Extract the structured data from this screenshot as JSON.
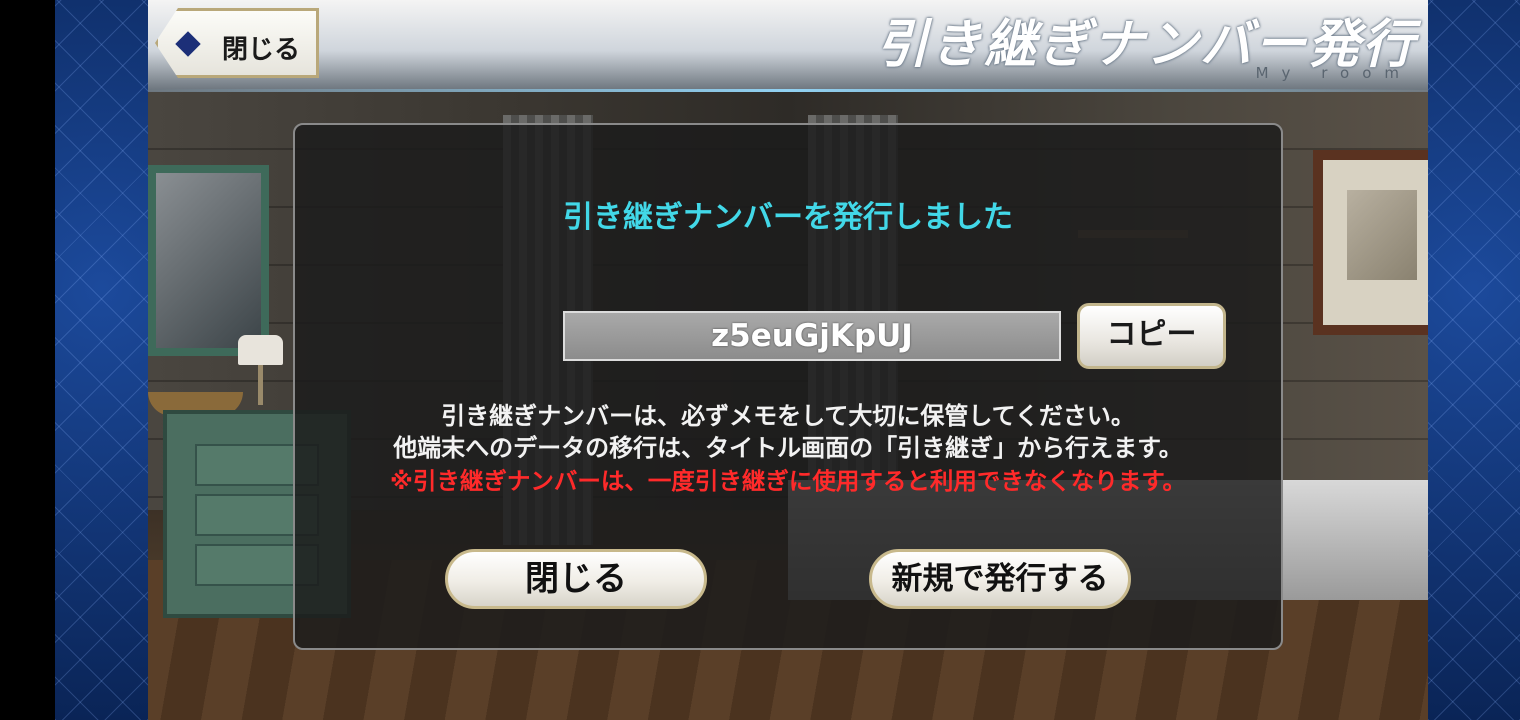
{
  "header": {
    "back_label": "閉じる",
    "title": "引き継ぎナンバー発行",
    "subtitle": "My room"
  },
  "dialog": {
    "heading": "引き継ぎナンバーを発行しました",
    "transfer_code": "z5euGjKpUJ",
    "copy_label": "コピー",
    "info_line_1": "引き継ぎナンバーは、必ずメモをして大切に保管してください。",
    "info_line_2": "他端末へのデータの移行は、タイトル画面の「引き継ぎ」から行えます。",
    "warning": "※引き継ぎナンバーは、一度引き継ぎに使用すると利用できなくなります。",
    "close_label": "閉じる",
    "reissue_label": "新規で発行する"
  },
  "colors": {
    "heading": "#42d8e8",
    "warning": "#ff2a2a",
    "frame": "#0d2d6b"
  },
  "icons": {
    "back": "diamond-back-icon"
  }
}
